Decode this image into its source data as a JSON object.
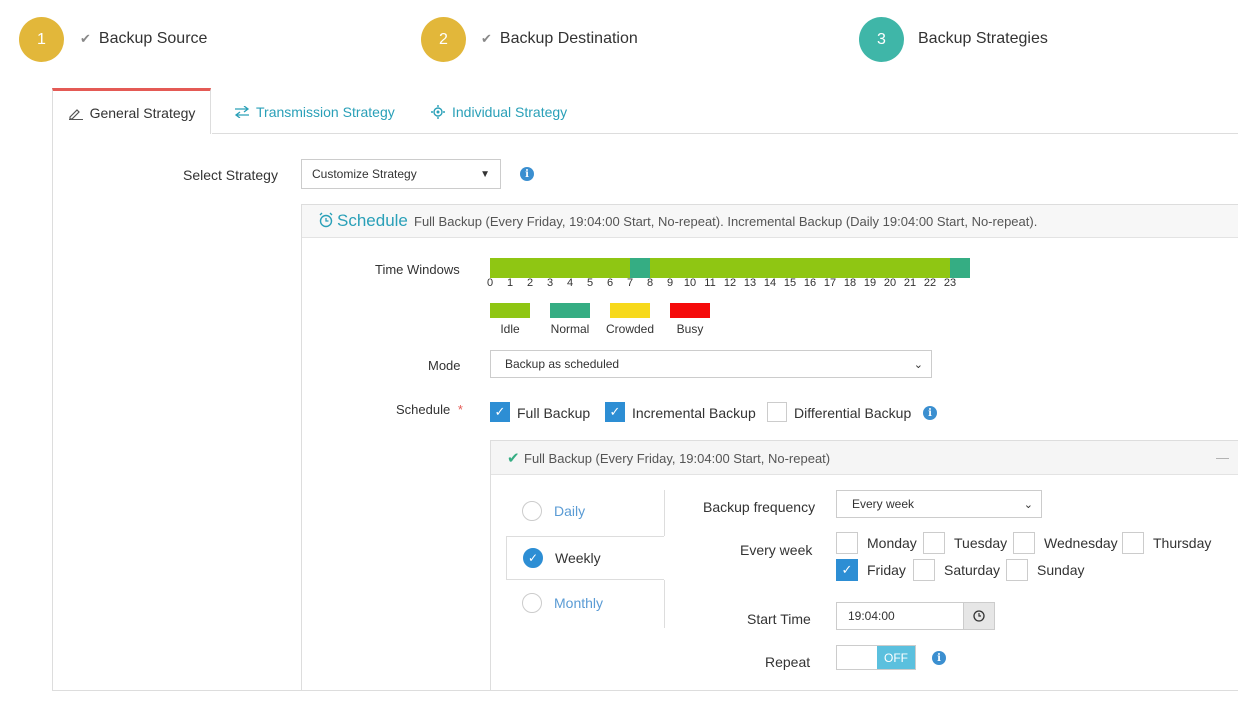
{
  "steps": [
    {
      "num": "1",
      "label": "Backup Source",
      "color": "#e2b73a"
    },
    {
      "num": "2",
      "label": "Backup Destination",
      "color": "#e2b73a"
    },
    {
      "num": "3",
      "label": "Backup Strategies",
      "color": "#3fb6a8"
    }
  ],
  "tabs": {
    "general": "General Strategy",
    "transmission": "Transmission Strategy",
    "individual": "Individual Strategy"
  },
  "strategy": {
    "label": "Select Strategy",
    "value": "Customize Strategy"
  },
  "schedule": {
    "title": "Schedule",
    "summary": "Full Backup (Every Friday, 19:04:00 Start, No-repeat). Incremental Backup (Daily 19:04:00 Start, No-repeat).",
    "time_windows_label": "Time Windows",
    "hours": [
      "0",
      "1",
      "2",
      "3",
      "4",
      "5",
      "6",
      "7",
      "8",
      "9",
      "10",
      "11",
      "12",
      "13",
      "14",
      "15",
      "16",
      "17",
      "18",
      "19",
      "20",
      "21",
      "22",
      "23"
    ],
    "hour_states": [
      "idle",
      "idle",
      "idle",
      "idle",
      "idle",
      "idle",
      "idle",
      "normal",
      "idle",
      "idle",
      "idle",
      "idle",
      "idle",
      "idle",
      "idle",
      "idle",
      "idle",
      "idle",
      "idle",
      "idle",
      "idle",
      "idle",
      "idle",
      "normal"
    ],
    "legend": [
      {
        "key": "idle",
        "label": "Idle",
        "color": "#8fc613"
      },
      {
        "key": "normal",
        "label": "Normal",
        "color": "#35ad83"
      },
      {
        "key": "crowded",
        "label": "Crowded",
        "color": "#f7d91b"
      },
      {
        "key": "busy",
        "label": "Busy",
        "color": "#f50a0a"
      }
    ],
    "mode_label": "Mode",
    "mode_value": "Backup as scheduled",
    "schedule_label": "Schedule",
    "required_mark": "*",
    "options": [
      {
        "label": "Full Backup",
        "checked": true
      },
      {
        "label": "Incremental Backup",
        "checked": true
      },
      {
        "label": "Differential Backup",
        "checked": false
      }
    ]
  },
  "full_backup": {
    "header": "Full Backup (Every Friday, 19:04:00 Start, No-repeat)",
    "collapse": "—",
    "frequencies": [
      {
        "label": "Daily",
        "selected": false
      },
      {
        "label": "Weekly",
        "selected": true
      },
      {
        "label": "Monthly",
        "selected": false
      }
    ],
    "backup_frequency_label": "Backup frequency",
    "backup_frequency_value": "Every week",
    "every_week_label": "Every week",
    "days": [
      {
        "label": "Monday",
        "checked": false
      },
      {
        "label": "Tuesday",
        "checked": false
      },
      {
        "label": "Wednesday",
        "checked": false
      },
      {
        "label": "Thursday",
        "checked": false
      },
      {
        "label": "Friday",
        "checked": true
      },
      {
        "label": "Saturday",
        "checked": false
      },
      {
        "label": "Sunday",
        "checked": false
      }
    ],
    "start_time_label": "Start Time",
    "start_time_value": "19:04:00",
    "repeat_label": "Repeat",
    "repeat_value": "OFF"
  }
}
